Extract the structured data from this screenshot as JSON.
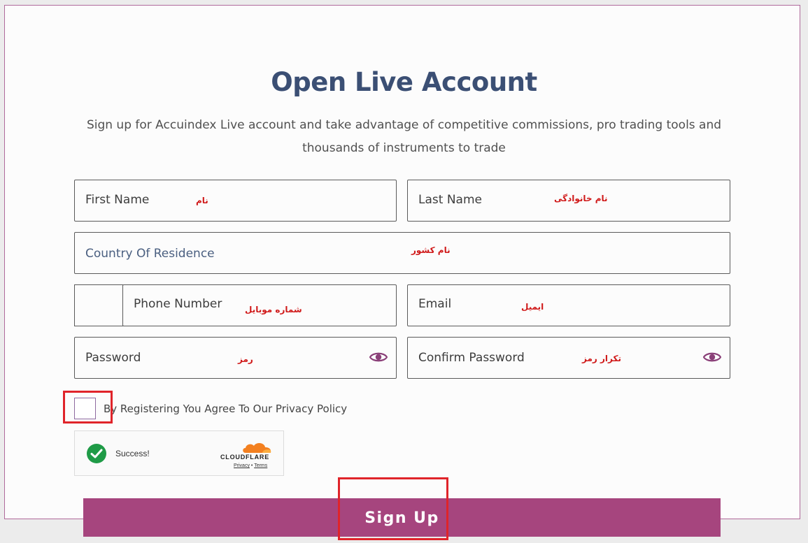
{
  "header": {
    "title": "Open Live Account",
    "subtitle": "Sign up for Accuindex Live account and take advantage of competitive commissions, pro trading tools and thousands of instruments to trade"
  },
  "form": {
    "first_name": {
      "placeholder": "First Name",
      "note": "نام"
    },
    "last_name": {
      "placeholder": "Last Name",
      "note": "نام خانوادگی"
    },
    "country": {
      "placeholder": "Country Of Residence",
      "note": "نام کشور"
    },
    "phone": {
      "placeholder": "Phone Number",
      "note": "شماره موبایل"
    },
    "email": {
      "placeholder": "Email",
      "note": "ایمیل"
    },
    "password": {
      "placeholder": "Password",
      "note": "رمز"
    },
    "confirm_password": {
      "placeholder": "Confirm Password",
      "note": "تکرار رمز"
    },
    "policy_text": "By Registering You Agree To Our Privacy Policy"
  },
  "captcha": {
    "status": "Success!",
    "brand": "CLOUDFLARE",
    "privacy": "Privacy",
    "separator": "•",
    "terms": "Terms"
  },
  "actions": {
    "signup_label": "Sign Up"
  },
  "colors": {
    "accent": "#a6457e",
    "title": "#3b4f74",
    "annotation": "#d01a1a"
  },
  "icons": [
    "eye-icon",
    "check-circle-icon",
    "cloud-icon"
  ]
}
